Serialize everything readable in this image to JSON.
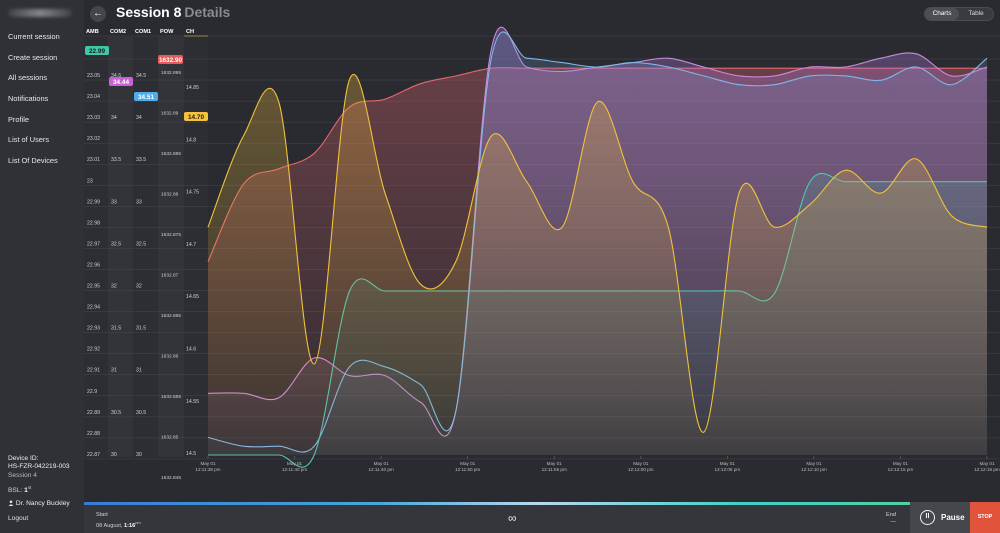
{
  "sidebar": {
    "nav": [
      {
        "label": "Current session"
      },
      {
        "label": "Create session"
      },
      {
        "label": "All sessions"
      },
      {
        "label": "Notifications"
      },
      {
        "label": "Profile"
      },
      {
        "label": "List of Users"
      },
      {
        "label": "List Of Devices"
      }
    ],
    "device_id_label": "Device ID:",
    "device_id": "HS-FZR-042219-003",
    "session": "Session 4",
    "bsl_label": "BSL:",
    "bsl_value": "1",
    "bsl_suffix": "st",
    "doctor": "Dr. Nancy Buckley",
    "doctor_icon": "person-icon",
    "logout": "Logout"
  },
  "header": {
    "back_icon": "arrow-left-icon",
    "back_glyph": "←",
    "title": "Session 8",
    "subtitle": "Details",
    "view_toggle": [
      "Charts",
      "Table"
    ],
    "active_view": "Charts"
  },
  "chart_data": {
    "type": "line",
    "columns": [
      "AMB",
      "COM2",
      "COM1",
      "POW",
      "CH"
    ],
    "x_ticks": [
      {
        "date": "May 01",
        "time": "12:11:38 pm"
      },
      {
        "date": "May 01",
        "time": "12:11:40 pm"
      },
      {
        "date": "May 01",
        "time": "12:11:40 pm"
      },
      {
        "date": "May 01",
        "time": "12:11:50 pm"
      },
      {
        "date": "May 01",
        "time": "12:11:55 pm"
      },
      {
        "date": "May 01",
        "time": "12:12:00 pm"
      },
      {
        "date": "May 01",
        "time": "12:12:05 pm"
      },
      {
        "date": "May 01",
        "time": "12:12:10 pm"
      },
      {
        "date": "May 01",
        "time": "12:12:15 pm"
      },
      {
        "date": "May 01",
        "time": "12:12:16 pm"
      }
    ],
    "amb_ticks": [
      "23.05",
      "23.04",
      "23.03",
      "23.02",
      "23.01",
      "23",
      "22.99",
      "22.98",
      "22.97",
      "22.96",
      "22.95",
      "22.94",
      "22.93",
      "22.92",
      "22.91",
      "22.9",
      "22.89",
      "22.88",
      "22.87"
    ],
    "com_ticks": [
      "34.5",
      "34",
      "33.5",
      "33",
      "32.5",
      "32",
      "31.5",
      "31",
      "30.5",
      "30"
    ],
    "pow_ticks": [
      "1632.895",
      "1632.89",
      "1632.885",
      "1632.88",
      "1632.875",
      "1632.87",
      "1632.865",
      "1632.86",
      "1632.855",
      "1632.85",
      "1632.845"
    ],
    "ch_ticks": [
      "14.85",
      "14.8",
      "14.75",
      "14.7",
      "14.65",
      "14.6",
      "14.55",
      "14.5"
    ],
    "current_values": [
      {
        "series": "AMB",
        "value": "22.99",
        "color": "#3fc8a8"
      },
      {
        "series": "COM2",
        "value": "34.44",
        "color": "#c763d6"
      },
      {
        "series": "COM1",
        "value": "34.51",
        "color": "#4faee8"
      },
      {
        "series": "POW",
        "value": "1632.90",
        "color": "#e8595c"
      },
      {
        "series": "CH",
        "value": "14.70",
        "color": "#f5c33b"
      }
    ],
    "series": [
      {
        "key": "POW",
        "color": "#e56570",
        "values": [
          1632.87,
          1632.88,
          1632.882,
          1632.884,
          1632.89,
          1632.891,
          1632.893,
          1632.894,
          1632.895,
          1632.895,
          1632.895,
          1632.895,
          1632.895,
          1632.895,
          1632.895,
          1632.895,
          1632.895,
          1632.895,
          1632.895,
          1632.895,
          1632.895,
          1632.895,
          1632.895
        ]
      },
      {
        "key": "COM2",
        "values": [
          30.7,
          30.7,
          30.65,
          31.1,
          30.9,
          30.9,
          30.6,
          30.5,
          34.6,
          34.4,
          34.35,
          34.4,
          34.45,
          34.5,
          34.4,
          34.3,
          34.3,
          34.4,
          34.4,
          34.5,
          34.55,
          34.3,
          34.4
        ],
        "color": "#c98be0"
      },
      {
        "key": "COM1",
        "values": [
          30.2,
          30.1,
          30.1,
          30.1,
          31.0,
          31.0,
          30.8,
          30.5,
          34.5,
          34.5,
          34.45,
          34.4,
          34.45,
          34.4,
          34.3,
          34.2,
          34.2,
          34.3,
          34.3,
          34.25,
          34.4,
          34.2,
          34.5
        ],
        "color": "#7fb7ea"
      },
      {
        "key": "AMB",
        "values": [
          22.87,
          22.87,
          22.87,
          22.87,
          22.942,
          22.942,
          22.942,
          22.942,
          22.942,
          22.942,
          22.942,
          22.942,
          22.942,
          22.942,
          22.942,
          22.942,
          22.941,
          22.99,
          22.99,
          22.99,
          22.99,
          22.99,
          22.99
        ],
        "color": "#52c4b3"
      },
      {
        "key": "CH",
        "values": [
          14.7,
          14.78,
          14.81,
          14.58,
          14.83,
          14.73,
          14.65,
          14.67,
          14.78,
          14.74,
          14.7,
          14.81,
          14.74,
          14.7,
          14.52,
          14.73,
          14.7,
          14.72,
          14.75,
          14.73,
          14.76,
          14.71,
          14.7
        ],
        "color": "#f0c23a"
      }
    ]
  },
  "footer": {
    "start_label": "Start",
    "start_date": "08 August,",
    "start_time": "1:16",
    "start_suffix": "pm",
    "loop_icon": "infinity-icon",
    "loop_glyph": "∞",
    "end_label": "End",
    "end_value": "—",
    "pause_icon": "pause-icon",
    "pause_glyph": "II",
    "pause_label": "Pause",
    "stop_label": "STOP"
  }
}
